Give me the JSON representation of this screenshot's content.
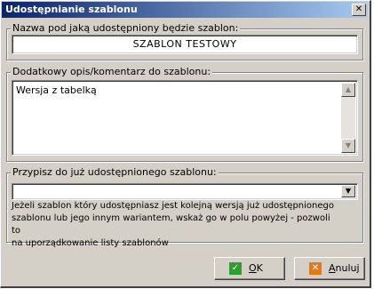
{
  "window": {
    "title": "Udostępnianie szablonu",
    "close_glyph": "✕"
  },
  "name_group": {
    "legend": "Nazwa pod jaką udostępniony będzie szablon:",
    "value": "SZABLON TESTOWY"
  },
  "description_group": {
    "legend": "Dodatkowy opis/komentarz do szablonu:",
    "value": "Wersja z tabelką",
    "scroll_up_glyph": "▲",
    "scroll_down_glyph": "▼"
  },
  "assign_group": {
    "legend": "Przypisz do już udostępnionego szablonu:",
    "selected_value": "",
    "dropdown_glyph": "▼",
    "hint": "Jeżeli szablon który udostępniasz jest kolejną wersją już udostępnionego\nszablonu lub jego innym wariantem, wskaż go w polu powyżej - pozwoli to\nna uporządkowanie listy szablonów"
  },
  "buttons": {
    "ok": {
      "label_underlined": "O",
      "label_rest": "K",
      "icon": "check-icon",
      "icon_glyph": "✓",
      "icon_color": "#2f9e2f"
    },
    "cancel": {
      "label_underlined": "A",
      "label_rest": "nuluj",
      "icon": "cross-icon",
      "icon_glyph": "✕",
      "icon_color": "#e07b1a"
    }
  }
}
